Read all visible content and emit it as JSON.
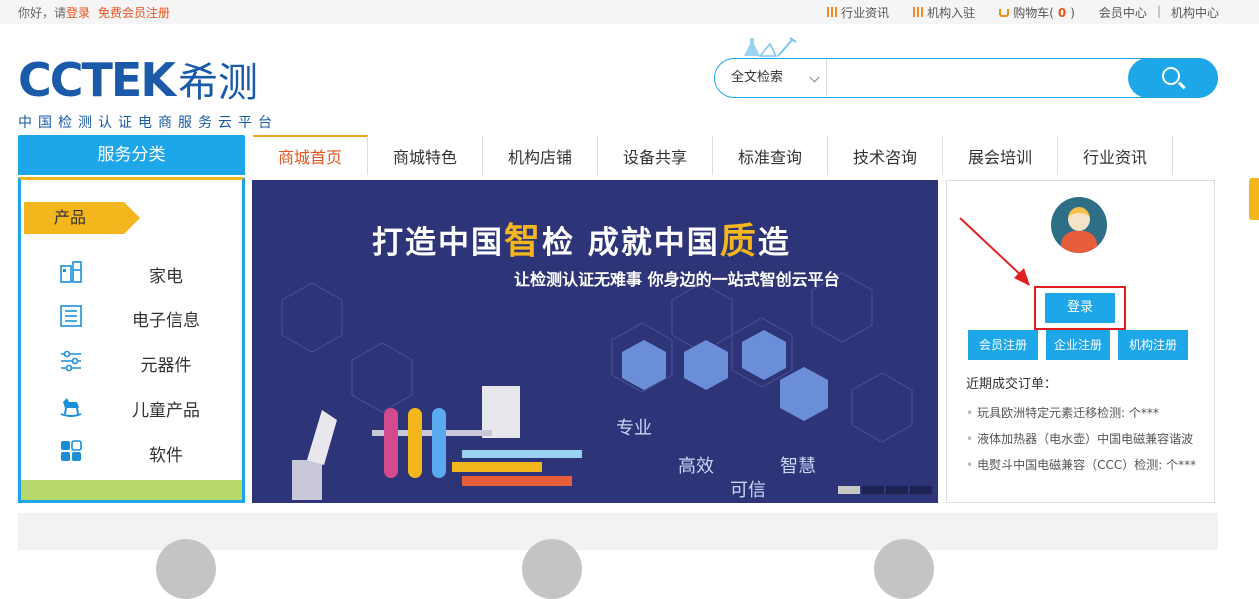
{
  "topbar": {
    "greeting": "你好，请",
    "login_link": "登录",
    "register_link": "免费会员注册",
    "news": "行业资讯",
    "join": "机构入驻",
    "cart_label": "购物车(",
    "cart_count": "0",
    "cart_close": ")",
    "member_center": "会员中心",
    "divider": "|",
    "org_center": "机构中心"
  },
  "logo": {
    "brand": "CCTEK",
    "brand_cn": "希测",
    "slogan": "中国检测认证电商服务云平台"
  },
  "search": {
    "scope": "全文检索",
    "placeholder": ""
  },
  "nav": {
    "category_title": "服务分类",
    "items": [
      "商城首页",
      "商城特色",
      "机构店铺",
      "设备共享",
      "标准查询",
      "技术咨询",
      "展会培训",
      "行业资讯"
    ]
  },
  "sidebar": {
    "tag": "产品",
    "items": [
      "家电",
      "电子信息",
      "元器件",
      "儿童产品",
      "软件"
    ]
  },
  "banner": {
    "headline_a": "打造中国",
    "headline_y1": "智",
    "headline_b": "检  成就中国",
    "headline_y2": "质",
    "headline_c": "造",
    "subline": "让检测认证无难事  你身边的一站式智创云平台",
    "kw1": "专业",
    "kw2": "高效",
    "kw3": "可信",
    "kw4": "智慧"
  },
  "login_panel": {
    "login_button": "登录",
    "member_register": "会员注册",
    "company_register": "企业注册",
    "org_register": "机构注册",
    "recent_title": "近期成交订单：",
    "orders": [
      "玩具欧洲特定元素迁移检测:  个***",
      "液体加热器（电水壶）中国电磁兼容谐波",
      "电熨斗中国电磁兼容（CCC）检测:  个***"
    ]
  },
  "colors": {
    "accent": "#1ea7e8",
    "highlight": "#e8541e",
    "tag": "#f3b61c",
    "banner_bg": "#2e3478"
  }
}
